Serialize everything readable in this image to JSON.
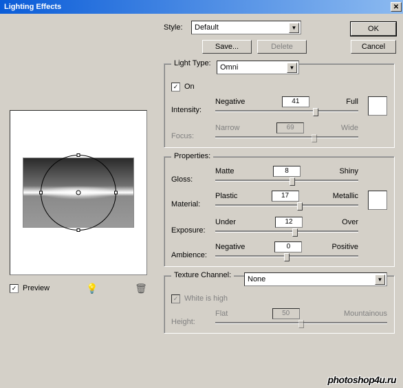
{
  "window": {
    "title": "Lighting Effects"
  },
  "buttons": {
    "ok": "OK",
    "cancel": "Cancel",
    "save": "Save...",
    "delete": "Delete"
  },
  "style": {
    "label": "Style:",
    "value": "Default"
  },
  "lightType": {
    "legend": "Light Type:",
    "value": "Omni",
    "on_label": "On",
    "on_checked": true,
    "intensity": {
      "label": "Intensity:",
      "min": "Negative",
      "max": "Full",
      "value": "41",
      "pct": 70
    },
    "focus": {
      "label": "Focus:",
      "min": "Narrow",
      "max": "Wide",
      "value": "69",
      "pct": 69,
      "disabled": true
    }
  },
  "properties": {
    "legend": "Properties:",
    "gloss": {
      "label": "Gloss:",
      "min": "Matte",
      "max": "Shiny",
      "value": "8",
      "pct": 54
    },
    "material": {
      "label": "Material:",
      "min": "Plastic",
      "max": "Metallic",
      "value": "17",
      "pct": 59
    },
    "exposure": {
      "label": "Exposure:",
      "min": "Under",
      "max": "Over",
      "value": "12",
      "pct": 56
    },
    "ambience": {
      "label": "Ambience:",
      "min": "Negative",
      "max": "Positive",
      "value": "0",
      "pct": 50
    }
  },
  "texture": {
    "legend": "Texture Channel:",
    "value": "None",
    "white_label": "White is high",
    "white_checked": true,
    "height": {
      "label": "Height:",
      "min": "Flat",
      "max": "Mountainous",
      "value": "50",
      "pct": 50,
      "disabled": true
    }
  },
  "preview": {
    "label": "Preview",
    "checked": true
  },
  "watermark": "photoshop4u.ru"
}
